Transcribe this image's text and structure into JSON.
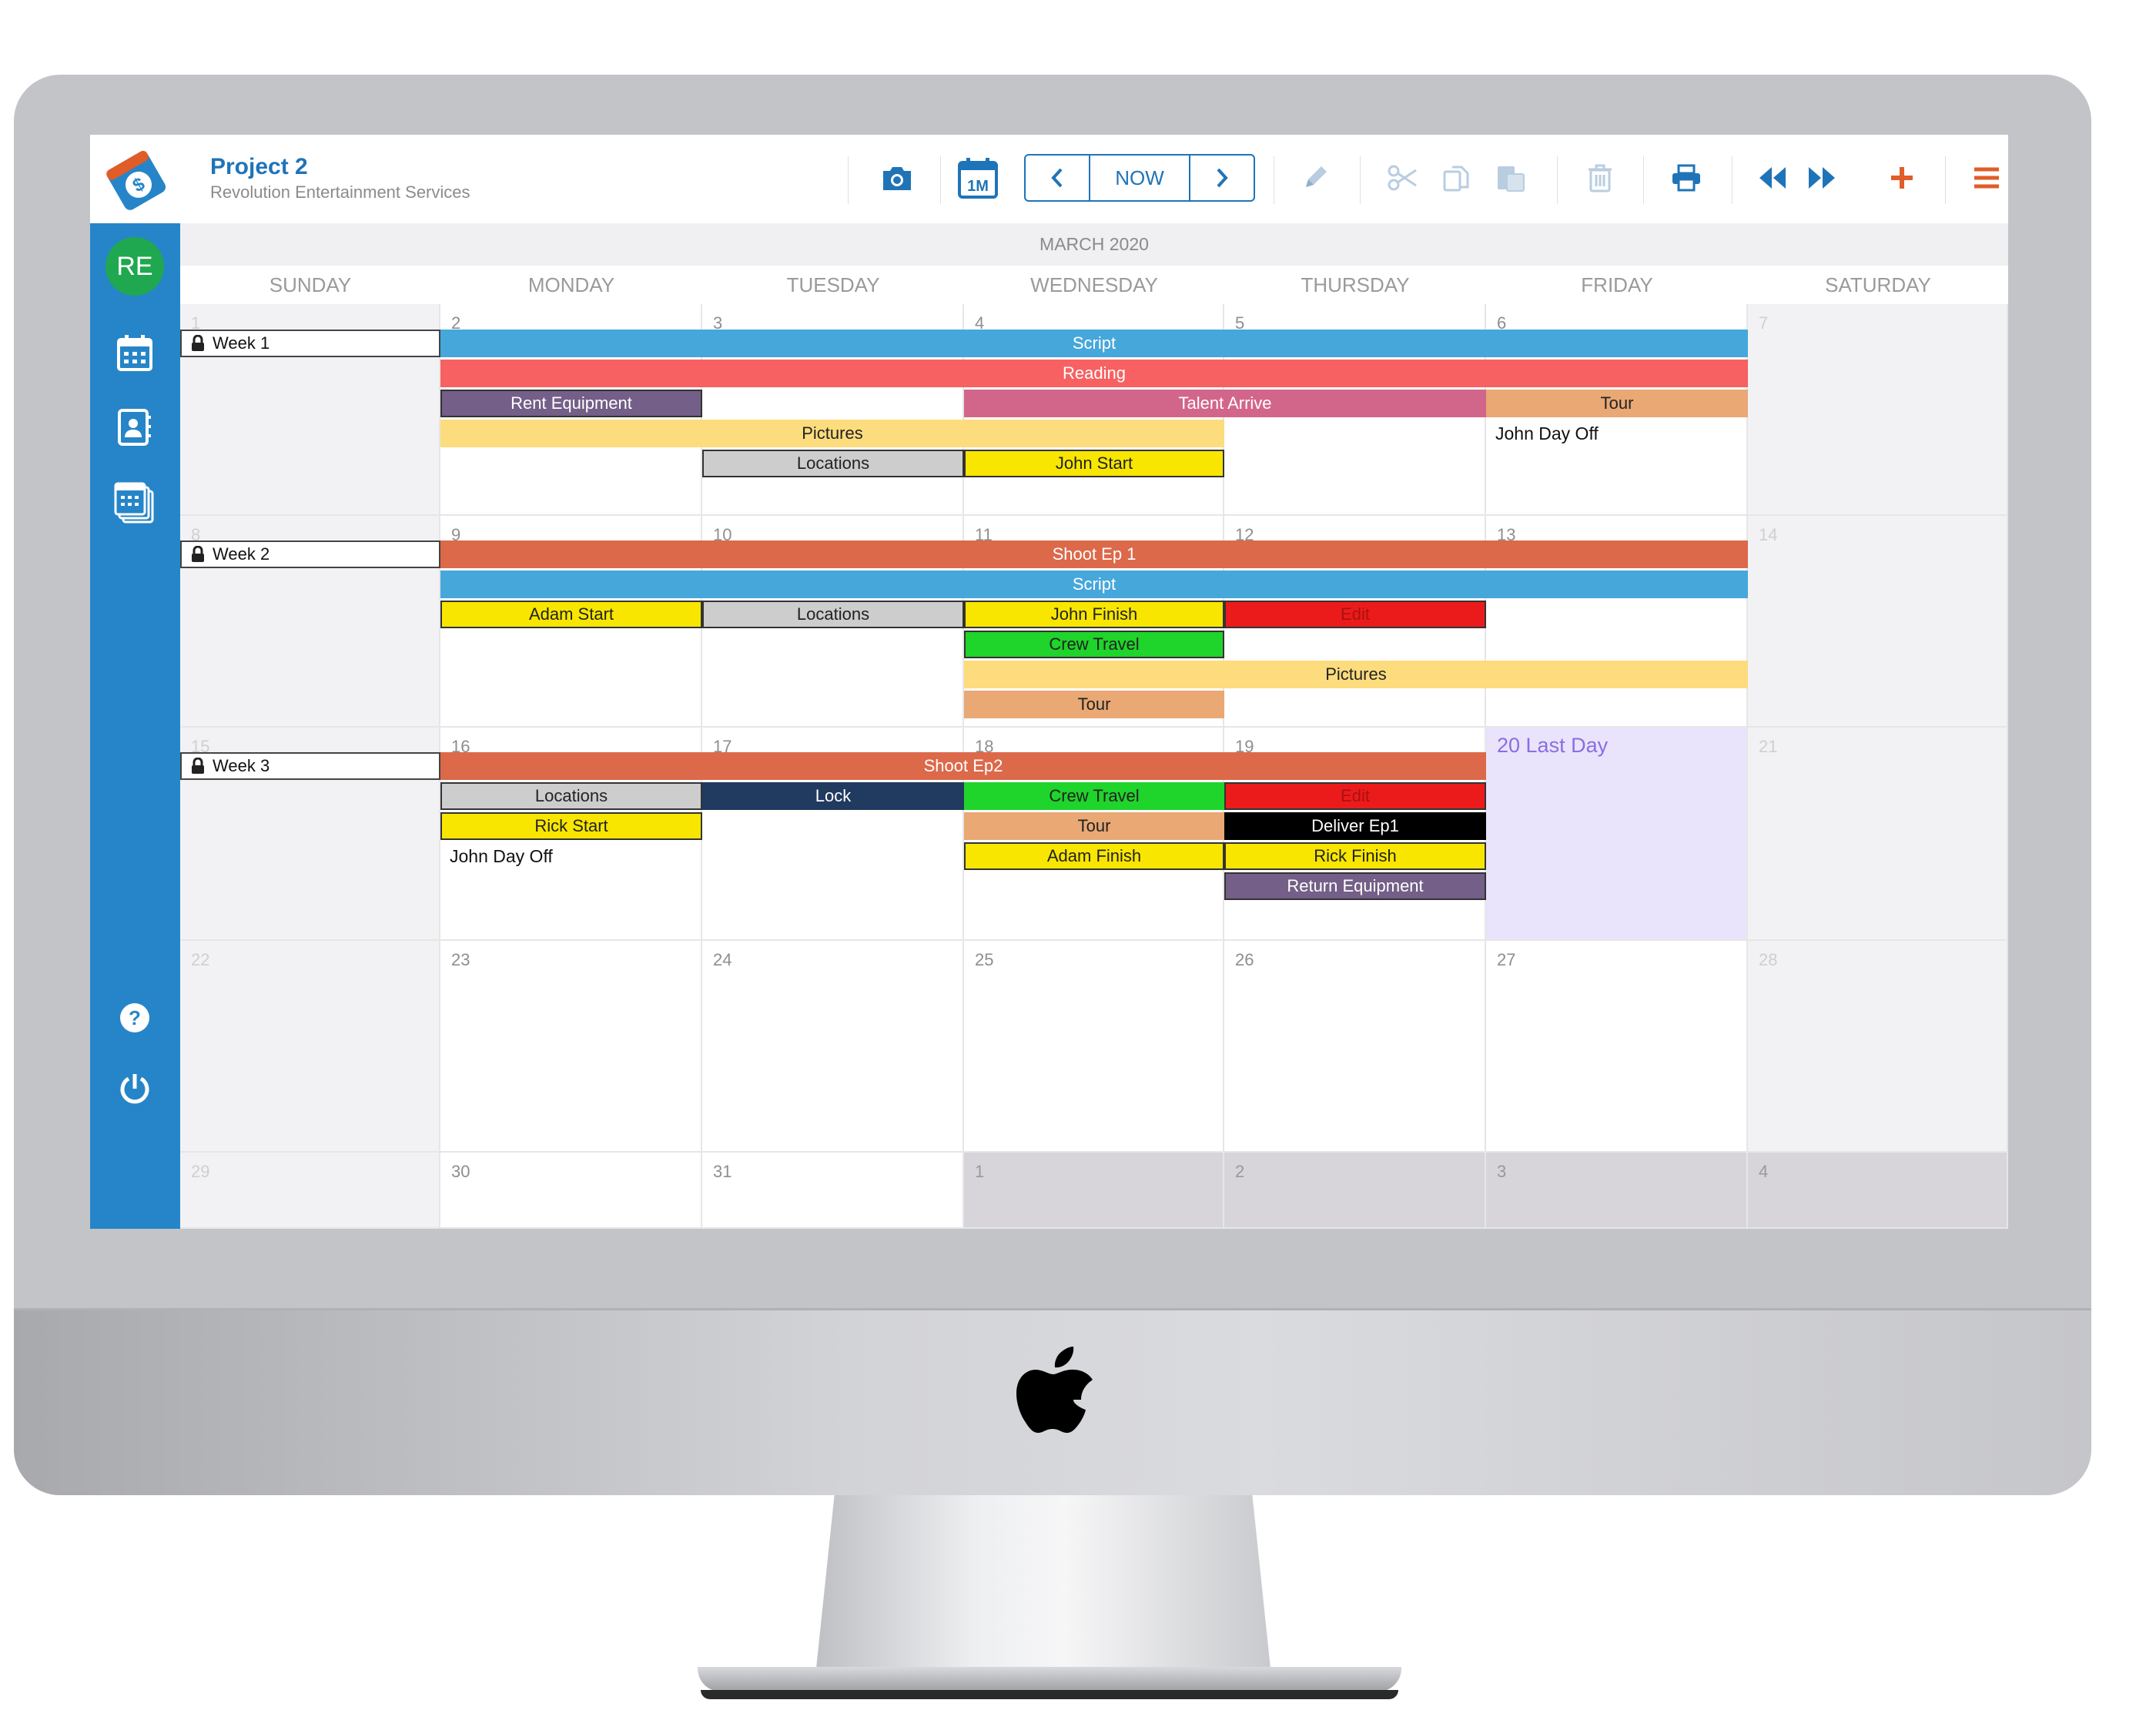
{
  "app": {
    "project_title": "Project 2",
    "company": "Revolution Entertainment Services",
    "user_initials": "RE"
  },
  "toolbar": {
    "view_label": "1M",
    "now_label": "NOW",
    "icons": [
      "camera-icon",
      "month-view-icon",
      "prev-icon",
      "next-icon",
      "pencil-icon",
      "scissors-icon",
      "copy-icon",
      "paste-icon",
      "trash-icon",
      "print-icon",
      "rewind-icon",
      "fast-forward-icon",
      "plus-icon",
      "menu-icon"
    ]
  },
  "colors": {
    "brand_blue": "#2685c8",
    "accent_orange": "#e05d28",
    "today_bg": "#e9e4fb"
  },
  "calendar": {
    "month_label": "MARCH 2020",
    "day_headers": [
      "SUNDAY",
      "MONDAY",
      "TUESDAY",
      "WEDNESDAY",
      "THURSDAY",
      "FRIDAY",
      "SATURDAY"
    ],
    "weeks": [
      [
        "1",
        "2",
        "3",
        "4",
        "5",
        "6",
        "7"
      ],
      [
        "8",
        "9",
        "10",
        "11",
        "12",
        "13",
        "14"
      ],
      [
        "15",
        "16",
        "17",
        "18",
        "19",
        "20",
        "21"
      ],
      [
        "22",
        "23",
        "24",
        "25",
        "26",
        "27",
        "28"
      ],
      [
        "29",
        "30",
        "31",
        "1",
        "2",
        "3",
        "4"
      ]
    ],
    "today_label": "20 Last Day",
    "week_labels": [
      "Week 1",
      "Week 2",
      "Week 3"
    ],
    "events": {
      "w1_script": "Script",
      "w1_reading": "Reading",
      "w1_rent_equipment": "Rent Equipment",
      "w1_talent_arrive": "Talent Arrive",
      "w1_tour": "Tour",
      "w1_pictures": "Pictures",
      "w1_john_day_off": "John Day Off",
      "w1_locations": "Locations",
      "w1_john_start": "John Start",
      "w2_shoot_ep1": "Shoot Ep 1",
      "w2_script": "Script",
      "w2_adam_start": "Adam Start",
      "w2_locations": "Locations",
      "w2_john_finish": "John Finish",
      "w2_edit": "Edit",
      "w2_crew_travel": "Crew Travel",
      "w2_pictures": "Pictures",
      "w2_tour": "Tour",
      "w3_shoot_ep2": "Shoot Ep2",
      "w3_locations": "Locations",
      "w3_lock": "Lock",
      "w3_crew_travel": "Crew Travel",
      "w3_edit": "Edit",
      "w3_rick_start": "Rick Start",
      "w3_tour": "Tour",
      "w3_deliver_ep1": "Deliver Ep1",
      "w3_john_day_off": "John Day Off",
      "w3_adam_finish": "Adam Finish",
      "w3_rick_finish": "Rick Finish",
      "w3_return_equipment": "Return Equipment"
    }
  }
}
